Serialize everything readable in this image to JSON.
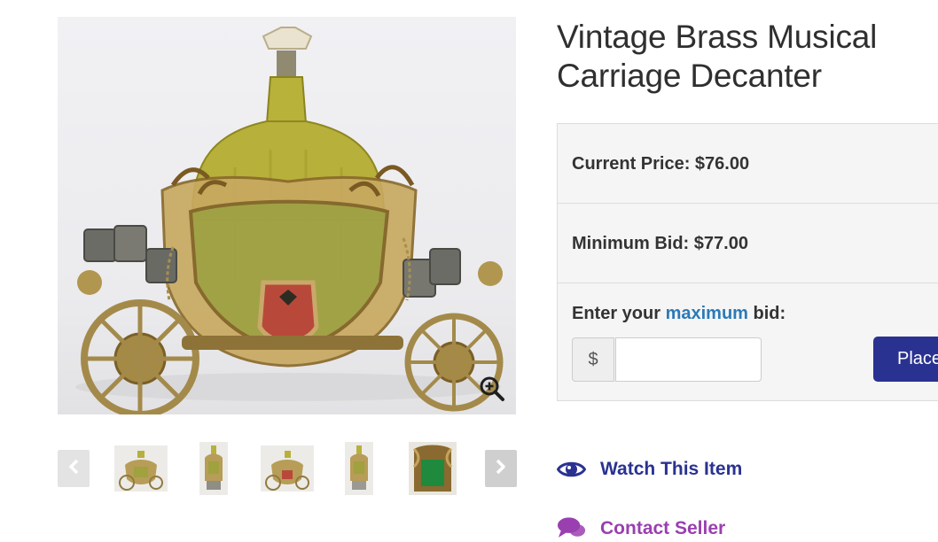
{
  "product": {
    "title": "Vintage Brass Musical Carriage Decanter"
  },
  "gallery": {
    "main_image_icon": "zoom-in-icon",
    "prev_icon": "chevron-left-icon",
    "next_icon": "chevron-right-icon",
    "thumbnail_count": 5
  },
  "bidding": {
    "current_price_label": "Current Price: $76.00",
    "minimum_bid_label": "Minimum Bid: $77.00",
    "enter_bid_prefix": "Enter your ",
    "enter_bid_highlight": "maximum",
    "enter_bid_suffix": " bid:",
    "currency_symbol": "$",
    "bid_input_value": "",
    "place_bid_label": "Place"
  },
  "actions": {
    "watch_label": "Watch This Item",
    "watch_icon": "eye-icon",
    "contact_label": "Contact Seller",
    "contact_icon": "chat-bubbles-icon"
  },
  "colors": {
    "primary": "#2a3291",
    "link": "#2a7ab8",
    "contact": "#9a3fb0"
  }
}
